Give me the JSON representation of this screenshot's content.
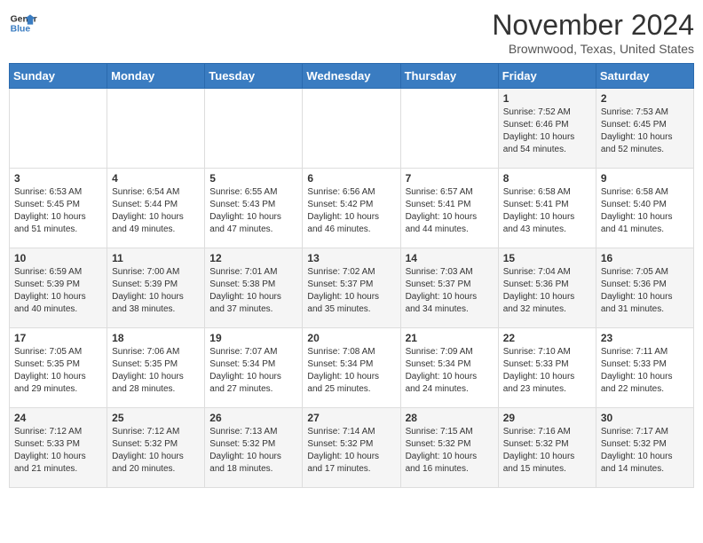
{
  "header": {
    "logo_line1": "General",
    "logo_line2": "Blue",
    "month_title": "November 2024",
    "location": "Brownwood, Texas, United States"
  },
  "days_of_week": [
    "Sunday",
    "Monday",
    "Tuesday",
    "Wednesday",
    "Thursday",
    "Friday",
    "Saturday"
  ],
  "weeks": [
    [
      {
        "day": "",
        "info": ""
      },
      {
        "day": "",
        "info": ""
      },
      {
        "day": "",
        "info": ""
      },
      {
        "day": "",
        "info": ""
      },
      {
        "day": "",
        "info": ""
      },
      {
        "day": "1",
        "info": "Sunrise: 7:52 AM\nSunset: 6:46 PM\nDaylight: 10 hours and 54 minutes."
      },
      {
        "day": "2",
        "info": "Sunrise: 7:53 AM\nSunset: 6:45 PM\nDaylight: 10 hours and 52 minutes."
      }
    ],
    [
      {
        "day": "3",
        "info": "Sunrise: 6:53 AM\nSunset: 5:45 PM\nDaylight: 10 hours and 51 minutes."
      },
      {
        "day": "4",
        "info": "Sunrise: 6:54 AM\nSunset: 5:44 PM\nDaylight: 10 hours and 49 minutes."
      },
      {
        "day": "5",
        "info": "Sunrise: 6:55 AM\nSunset: 5:43 PM\nDaylight: 10 hours and 47 minutes."
      },
      {
        "day": "6",
        "info": "Sunrise: 6:56 AM\nSunset: 5:42 PM\nDaylight: 10 hours and 46 minutes."
      },
      {
        "day": "7",
        "info": "Sunrise: 6:57 AM\nSunset: 5:41 PM\nDaylight: 10 hours and 44 minutes."
      },
      {
        "day": "8",
        "info": "Sunrise: 6:58 AM\nSunset: 5:41 PM\nDaylight: 10 hours and 43 minutes."
      },
      {
        "day": "9",
        "info": "Sunrise: 6:58 AM\nSunset: 5:40 PM\nDaylight: 10 hours and 41 minutes."
      }
    ],
    [
      {
        "day": "10",
        "info": "Sunrise: 6:59 AM\nSunset: 5:39 PM\nDaylight: 10 hours and 40 minutes."
      },
      {
        "day": "11",
        "info": "Sunrise: 7:00 AM\nSunset: 5:39 PM\nDaylight: 10 hours and 38 minutes."
      },
      {
        "day": "12",
        "info": "Sunrise: 7:01 AM\nSunset: 5:38 PM\nDaylight: 10 hours and 37 minutes."
      },
      {
        "day": "13",
        "info": "Sunrise: 7:02 AM\nSunset: 5:37 PM\nDaylight: 10 hours and 35 minutes."
      },
      {
        "day": "14",
        "info": "Sunrise: 7:03 AM\nSunset: 5:37 PM\nDaylight: 10 hours and 34 minutes."
      },
      {
        "day": "15",
        "info": "Sunrise: 7:04 AM\nSunset: 5:36 PM\nDaylight: 10 hours and 32 minutes."
      },
      {
        "day": "16",
        "info": "Sunrise: 7:05 AM\nSunset: 5:36 PM\nDaylight: 10 hours and 31 minutes."
      }
    ],
    [
      {
        "day": "17",
        "info": "Sunrise: 7:05 AM\nSunset: 5:35 PM\nDaylight: 10 hours and 29 minutes."
      },
      {
        "day": "18",
        "info": "Sunrise: 7:06 AM\nSunset: 5:35 PM\nDaylight: 10 hours and 28 minutes."
      },
      {
        "day": "19",
        "info": "Sunrise: 7:07 AM\nSunset: 5:34 PM\nDaylight: 10 hours and 27 minutes."
      },
      {
        "day": "20",
        "info": "Sunrise: 7:08 AM\nSunset: 5:34 PM\nDaylight: 10 hours and 25 minutes."
      },
      {
        "day": "21",
        "info": "Sunrise: 7:09 AM\nSunset: 5:34 PM\nDaylight: 10 hours and 24 minutes."
      },
      {
        "day": "22",
        "info": "Sunrise: 7:10 AM\nSunset: 5:33 PM\nDaylight: 10 hours and 23 minutes."
      },
      {
        "day": "23",
        "info": "Sunrise: 7:11 AM\nSunset: 5:33 PM\nDaylight: 10 hours and 22 minutes."
      }
    ],
    [
      {
        "day": "24",
        "info": "Sunrise: 7:12 AM\nSunset: 5:33 PM\nDaylight: 10 hours and 21 minutes."
      },
      {
        "day": "25",
        "info": "Sunrise: 7:12 AM\nSunset: 5:32 PM\nDaylight: 10 hours and 20 minutes."
      },
      {
        "day": "26",
        "info": "Sunrise: 7:13 AM\nSunset: 5:32 PM\nDaylight: 10 hours and 18 minutes."
      },
      {
        "day": "27",
        "info": "Sunrise: 7:14 AM\nSunset: 5:32 PM\nDaylight: 10 hours and 17 minutes."
      },
      {
        "day": "28",
        "info": "Sunrise: 7:15 AM\nSunset: 5:32 PM\nDaylight: 10 hours and 16 minutes."
      },
      {
        "day": "29",
        "info": "Sunrise: 7:16 AM\nSunset: 5:32 PM\nDaylight: 10 hours and 15 minutes."
      },
      {
        "day": "30",
        "info": "Sunrise: 7:17 AM\nSunset: 5:32 PM\nDaylight: 10 hours and 14 minutes."
      }
    ]
  ]
}
